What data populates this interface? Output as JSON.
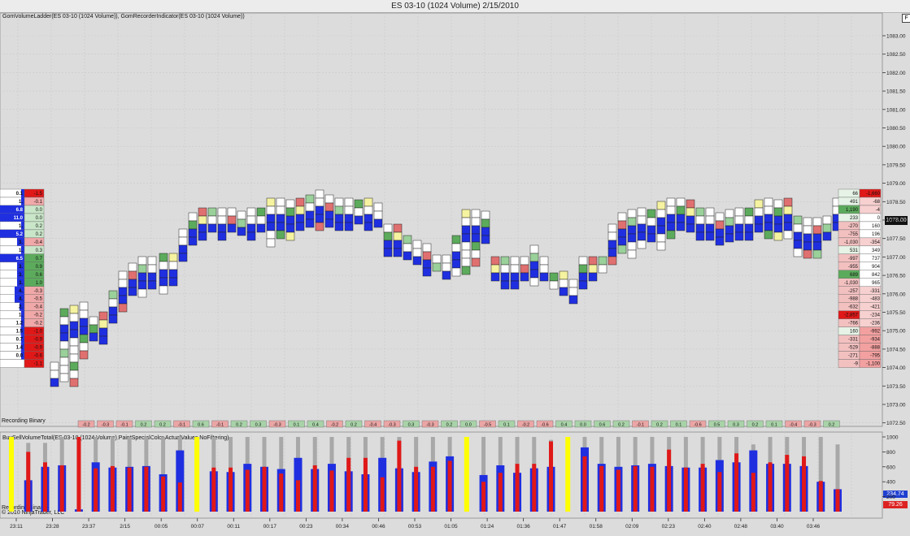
{
  "window": {
    "title": "ES 03-10 (1024 Volume)  2/15/2010"
  },
  "panels": {
    "top_indicator": "GomVolumeLadder(ES 03-10 (1024 Volume)), GomRecorderIndicator(ES 03-10 (1024 Volume))",
    "bottom_indicator": "BuySellVolumeTotal(ES 03-10 (1024 Volume),PaintSpecialColor,ActualValues,NoFiltering)",
    "recording_label_top": "Recording Binary",
    "recording_label_bottom": "Recording Binary",
    "copyright": "© 2010 NinjaTrader, LLC"
  },
  "colors": {
    "up": "#1f2fe0",
    "down": "#e01818",
    "neutral": "#a8a8a8",
    "special": "#ffff00",
    "green_cell": "#5cab5c",
    "red_cell": "#e07070",
    "chart_bg": "#dcdcdc"
  },
  "price_axis": {
    "ticks": [
      "1083.00",
      "1082.50",
      "1082.00",
      "1081.50",
      "1081.00",
      "1080.50",
      "1080.00",
      "1079.50",
      "1079.00",
      "1078.50",
      "1078.00",
      "1077.50",
      "1077.00",
      "1076.50",
      "1076.00",
      "1075.50",
      "1075.00",
      "1074.50",
      "1074.00",
      "1073.50",
      "1073.00",
      "1072.50"
    ],
    "current": "1078.00"
  },
  "volume_axis": {
    "ticks": [
      "1000",
      "800",
      "600",
      "400",
      "200"
    ],
    "current_buy": "234.74",
    "current_sell": "79.26"
  },
  "time_axis": [
    "23:11",
    "23:28",
    "23:37",
    "2/15",
    "00:05",
    "00:07",
    "00:11",
    "00:17",
    "00:23",
    "00:34",
    "00:46",
    "00:53",
    "01:05",
    "01:24",
    "01:36",
    "01:47",
    "01:58",
    "02:09",
    "02:23",
    "02:40",
    "02:48",
    "03:40",
    "03:46"
  ],
  "left_ladder": {
    "col1": [
      "0.1",
      "1.",
      "6.8",
      "11.0",
      "1.",
      "5.2",
      "3.",
      "1.",
      "6.5",
      "3.",
      "3.",
      "3.",
      "4.",
      "4.",
      "2.",
      "1.",
      "1.2",
      "1.5",
      "0.7",
      "1.4",
      "0.0"
    ],
    "col2": [
      "-1.5",
      "-0.1",
      "0.0",
      "0.0",
      "0.2",
      "0.2",
      "-0.4",
      "0.3",
      "0.7",
      "0.9",
      "0.6",
      "1.0",
      "-0.3",
      "-0.5",
      "-0.4",
      "-0.2",
      "-0.2",
      "-1.0",
      "-0.9",
      "-0.9",
      "-0.6",
      "-1.1"
    ]
  },
  "right_ladder": {
    "col1": [
      "66",
      "491",
      "1,190",
      "233",
      "-270",
      "-755",
      "-1,030",
      "531",
      "-997",
      "-955",
      "689",
      "-1,030",
      "-257",
      "-988",
      "-632",
      "-2,857",
      "-766",
      "160",
      "-331",
      "-529",
      "-271",
      "-9"
    ],
    "col2": [
      "-1,660",
      "-68",
      "-4",
      "0",
      "160",
      "196",
      "-354",
      "349",
      "737",
      "904",
      "842",
      "965",
      "-331",
      "-483",
      "-421",
      "-234",
      "-236",
      "-992",
      "-934",
      "-888",
      "-795",
      "-1,100"
    ]
  },
  "delta_row": [
    "-0.2",
    "-0.3",
    "-0.1",
    "0.2",
    "0.2",
    "-0.1",
    "0.6",
    "-0.1",
    "0.2",
    "0.3",
    "-0.3",
    "0.1",
    "0.4",
    "-0.2",
    "0.2",
    "-0.4",
    "-0.3",
    "0.3",
    "-0.3",
    "0.2",
    "0.0",
    "-0.5",
    "0.1",
    "-0.2",
    "-0.6",
    "0.4",
    "0.0",
    "0.6",
    "0.2",
    "-0.1",
    "0.2",
    "0.1",
    "-0.6",
    "0.5",
    "0.3",
    "0.2",
    "0.1",
    "-0.4",
    "-0.3",
    "0.2"
  ],
  "chart_data": {
    "type": "bar",
    "series": [
      {
        "name": "Total",
        "color": "#a8a8a8"
      },
      {
        "name": "Buy",
        "color": "#1f2fe0"
      },
      {
        "name": "Sell",
        "color": "#e01818"
      }
    ],
    "bars": [
      {
        "total": 1000,
        "buy": 0,
        "sell": 0,
        "special": true
      },
      {
        "total": 920,
        "buy": 420,
        "sell": 800
      },
      {
        "total": 920,
        "buy": 600,
        "sell": 660
      },
      {
        "total": 1000,
        "buy": 620,
        "sell": 620
      },
      {
        "total": 1000,
        "buy": 30,
        "sell": 1000
      },
      {
        "total": 1000,
        "buy": 660,
        "sell": 580
      },
      {
        "total": 1000,
        "buy": 590,
        "sell": 610
      },
      {
        "total": 1000,
        "buy": 600,
        "sell": 590
      },
      {
        "total": 1000,
        "buy": 610,
        "sell": 600
      },
      {
        "total": 1000,
        "buy": 500,
        "sell": 470
      },
      {
        "total": 1000,
        "buy": 820,
        "sell": 390
      },
      {
        "total": 1000,
        "buy": 0,
        "sell": 0,
        "special": true
      },
      {
        "total": 1000,
        "buy": 540,
        "sell": 590
      },
      {
        "total": 1000,
        "buy": 530,
        "sell": 590
      },
      {
        "total": 1000,
        "buy": 640,
        "sell": 560
      },
      {
        "total": 1000,
        "buy": 600,
        "sell": 600
      },
      {
        "total": 1000,
        "buy": 570,
        "sell": 510
      },
      {
        "total": 1000,
        "buy": 720,
        "sell": 420
      },
      {
        "total": 1000,
        "buy": 570,
        "sell": 620
      },
      {
        "total": 1000,
        "buy": 640,
        "sell": 550
      },
      {
        "total": 1000,
        "buy": 540,
        "sell": 720
      },
      {
        "total": 1000,
        "buy": 500,
        "sell": 720
      },
      {
        "total": 1000,
        "buy": 720,
        "sell": 460
      },
      {
        "total": 1000,
        "buy": 580,
        "sell": 950
      },
      {
        "total": 1000,
        "buy": 530,
        "sell": 600
      },
      {
        "total": 1000,
        "buy": 670,
        "sell": 600
      },
      {
        "total": 1000,
        "buy": 740,
        "sell": 680
      },
      {
        "total": 1000,
        "buy": 0,
        "sell": 0,
        "special": true
      },
      {
        "total": 1000,
        "buy": 490,
        "sell": 400
      },
      {
        "total": 1000,
        "buy": 620,
        "sell": 520
      },
      {
        "total": 1000,
        "buy": 520,
        "sell": 640
      },
      {
        "total": 1000,
        "buy": 580,
        "sell": 640
      },
      {
        "total": 960,
        "buy": 600,
        "sell": 940
      },
      {
        "total": 1000,
        "buy": 0,
        "sell": 0,
        "special": true
      },
      {
        "total": 1000,
        "buy": 860,
        "sell": 740
      },
      {
        "total": 1000,
        "buy": 640,
        "sell": 610
      },
      {
        "total": 1000,
        "buy": 600,
        "sell": 560
      },
      {
        "total": 1000,
        "buy": 620,
        "sell": 610
      },
      {
        "total": 1000,
        "buy": 640,
        "sell": 600
      },
      {
        "total": 1000,
        "buy": 610,
        "sell": 830
      },
      {
        "total": 1000,
        "buy": 590,
        "sell": 590
      },
      {
        "total": 1000,
        "buy": 590,
        "sell": 640
      },
      {
        "total": 1000,
        "buy": 690,
        "sell": 530
      },
      {
        "total": 1000,
        "buy": 660,
        "sell": 780
      },
      {
        "total": 900,
        "buy": 820,
        "sell": 520
      },
      {
        "total": 1000,
        "buy": 640,
        "sell": 660
      },
      {
        "total": 1000,
        "buy": 640,
        "sell": 760
      },
      {
        "total": 1000,
        "buy": 610,
        "sell": 740
      },
      {
        "total": 1000,
        "buy": 400,
        "sell": 410
      },
      {
        "total": 900,
        "buy": 300,
        "sell": 300
      }
    ],
    "ylim": [
      0,
      1050
    ]
  }
}
